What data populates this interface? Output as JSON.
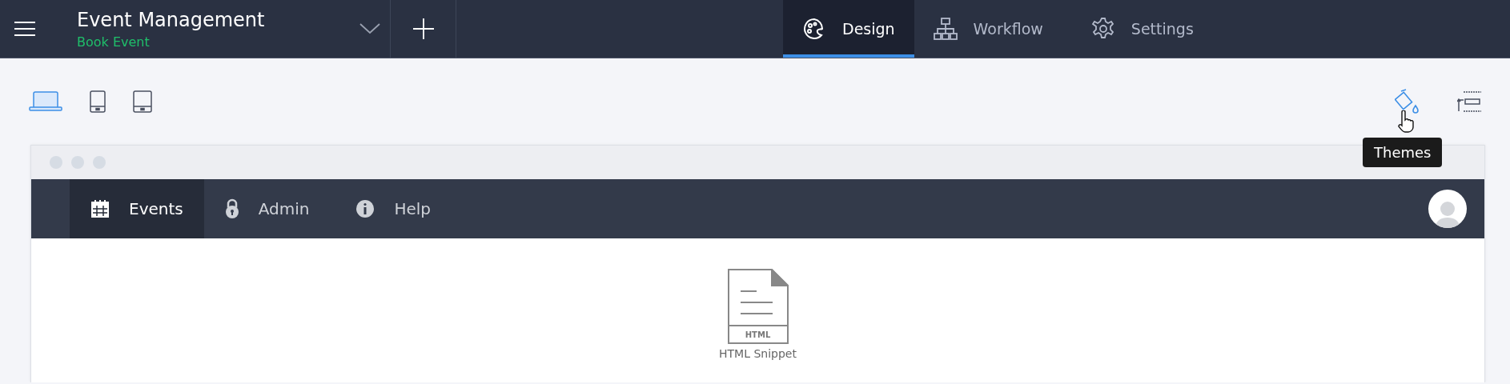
{
  "header": {
    "app_title": "Event Management",
    "form_name": "Book Event"
  },
  "tabs": [
    {
      "kind": "design",
      "label": "Design",
      "selected": true
    },
    {
      "kind": "workflow",
      "label": "Workflow",
      "selected": false
    },
    {
      "kind": "settings",
      "label": "Settings",
      "selected": false
    }
  ],
  "devices": [
    {
      "kind": "laptop",
      "selected": true
    },
    {
      "kind": "phone",
      "selected": false
    },
    {
      "kind": "tablet",
      "selected": false
    }
  ],
  "tooltip": "Themes",
  "preview": {
    "nav": [
      {
        "kind": "calendar",
        "label": "Events",
        "selected": true
      },
      {
        "kind": "lock",
        "label": "Admin",
        "selected": false
      },
      {
        "kind": "info",
        "label": "Help",
        "selected": false
      }
    ],
    "snippet": {
      "badge": "HTML",
      "label": "HTML Snippet"
    }
  }
}
